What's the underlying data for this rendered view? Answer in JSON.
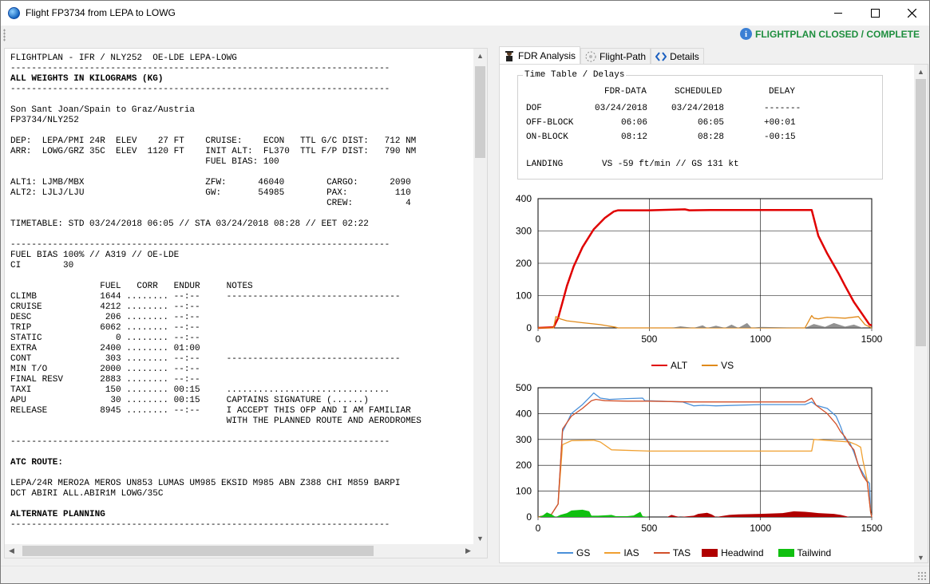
{
  "window": {
    "title": "Flight FP3734 from LEPA to LOWG",
    "status": "FLIGHTPLAN CLOSED / COMPLETE",
    "status_color": "#1e8e3e"
  },
  "ofp_lines": [
    {
      "text": "FLIGHTPLAN - IFR / NLY252  OE-LDE LEPA-LOWG",
      "bold": false
    },
    {
      "text": "------------------------------------------------------------------------",
      "bold": false
    },
    {
      "text": "ALL WEIGHTS IN KILOGRAMS (KG)",
      "bold": true
    },
    {
      "text": "------------------------------------------------------------------------",
      "bold": false
    },
    {
      "text": "",
      "bold": false
    },
    {
      "text": "Son Sant Joan/Spain to Graz/Austria",
      "bold": false
    },
    {
      "text": "FP3734/NLY252",
      "bold": false
    },
    {
      "text": "",
      "bold": false
    },
    {
      "text": "DEP:  LEPA/PMI 24R  ELEV    27 FT    CRUISE:    ECON   TTL G/C DIST:   712 NM",
      "bold": false
    },
    {
      "text": "ARR:  LOWG/GRZ 35C  ELEV  1120 FT    INIT ALT:  FL370  TTL F/P DIST:   790 NM",
      "bold": false
    },
    {
      "text": "                                     FUEL BIAS: 100",
      "bold": false
    },
    {
      "text": "",
      "bold": false
    },
    {
      "text": "ALT1: LJMB/MBX                       ZFW:      46040        CARGO:      2090",
      "bold": false
    },
    {
      "text": "ALT2: LJLJ/LJU                       GW:       54985        PAX:         110",
      "bold": false
    },
    {
      "text": "                                                            CREW:          4",
      "bold": false
    },
    {
      "text": "",
      "bold": false
    },
    {
      "text": "TIMETABLE: STD 03/24/2018 06:05 // STA 03/24/2018 08:28 // EET 02:22",
      "bold": false
    },
    {
      "text": "",
      "bold": false
    },
    {
      "text": "------------------------------------------------------------------------",
      "bold": false
    },
    {
      "text": "FUEL BIAS 100% // A319 // OE-LDE",
      "bold": false
    },
    {
      "text": "CI        30",
      "bold": false
    },
    {
      "text": "",
      "bold": false
    },
    {
      "text": "                 FUEL   CORR   ENDUR     NOTES",
      "bold": false
    },
    {
      "text": "CLIMB            1644 ........ --:--     ---------------------------------",
      "bold": false
    },
    {
      "text": "CRUISE           4212 ........ --:--",
      "bold": false
    },
    {
      "text": "DESC              206 ........ --:--",
      "bold": false
    },
    {
      "text": "TRIP             6062 ........ --:--",
      "bold": false
    },
    {
      "text": "STATIC              0 ........ --:--",
      "bold": false
    },
    {
      "text": "EXTRA            2400 ........ 01:00",
      "bold": false
    },
    {
      "text": "CONT              303 ........ --:--     ---------------------------------",
      "bold": false
    },
    {
      "text": "MIN T/O          2000 ........ --:--",
      "bold": false
    },
    {
      "text": "FINAL RESV       2883 ........ --:--",
      "bold": false
    },
    {
      "text": "TAXI              150 ........ 00:15     ...............................",
      "bold": false
    },
    {
      "text": "APU                30 ........ 00:15     CAPTAINS SIGNATURE (......)",
      "bold": false
    },
    {
      "text": "RELEASE          8945 ........ --:--     I ACCEPT THIS OFP AND I AM FAMILIAR",
      "bold": false
    },
    {
      "text": "                                         WITH THE PLANNED ROUTE AND AERODROMES",
      "bold": false
    },
    {
      "text": "",
      "bold": false
    },
    {
      "text": "------------------------------------------------------------------------",
      "bold": false
    },
    {
      "text": "",
      "bold": false
    },
    {
      "text": "ATC ROUTE:",
      "bold": true
    },
    {
      "text": "",
      "bold": false
    },
    {
      "text": "LEPA/24R MERO2A MEROS UN853 LUMAS UM985 EKSID M985 ABN Z388 CHI M859 BARPI",
      "bold": false
    },
    {
      "text": "DCT ABIRI ALL.ABIR1M LOWG/35C",
      "bold": false
    },
    {
      "text": "",
      "bold": false
    },
    {
      "text": "ALTERNATE PLANNING",
      "bold": true
    },
    {
      "text": "------------------------------------------------------------------------",
      "bold": false
    }
  ],
  "tabs": [
    {
      "label": "FDR Analysis",
      "icon": "pilot-icon",
      "active": true
    },
    {
      "label": "Flight-Path",
      "icon": "radar-icon",
      "active": false
    },
    {
      "label": "Details",
      "icon": "code-icon",
      "active": false
    }
  ],
  "timetable": {
    "title": "Time Table / Delays",
    "col_fdr": "FDR-DATA",
    "col_sched": "SCHEDULED",
    "col_delay": "DELAY",
    "rows": [
      {
        "label": "DOF",
        "fdr": "03/24/2018",
        "sched": "03/24/2018",
        "delay": "-------"
      },
      {
        "label": "OFF-BLOCK",
        "fdr": "06:06",
        "sched": "06:05",
        "delay": "+00:01"
      },
      {
        "label": "ON-BLOCK",
        "fdr": "08:12",
        "sched": "08:28",
        "delay": "-00:15"
      }
    ],
    "landing_label": "LANDING",
    "landing_value": "VS -59 ft/min // GS 131 kt"
  },
  "chart_data": [
    {
      "type": "line",
      "xlim": [
        0,
        1500
      ],
      "ylim": [
        0,
        400
      ],
      "xticks": [
        "0",
        "500",
        "1000",
        "1500"
      ],
      "yticks": [
        "0",
        "100",
        "200",
        "300",
        "400"
      ],
      "grid": true,
      "legend_position": "bottom",
      "series": [
        {
          "name": "ALT",
          "color": "#e00000",
          "x": [
            0,
            70,
            90,
            110,
            130,
            160,
            200,
            250,
            300,
            340,
            360,
            500,
            660,
            680,
            800,
            1000,
            1100,
            1230,
            1260,
            1300,
            1350,
            1380,
            1420,
            1460,
            1490,
            1500
          ],
          "y": [
            0,
            2,
            30,
            80,
            130,
            190,
            250,
            305,
            340,
            360,
            364,
            364,
            367,
            364,
            365,
            365,
            365,
            365,
            285,
            230,
            170,
            130,
            80,
            40,
            10,
            8
          ]
        },
        {
          "name": "VS",
          "color": "#e08a1a",
          "x": [
            0,
            70,
            80,
            100,
            130,
            200,
            280,
            350,
            360,
            1200,
            1230,
            1240,
            1260,
            1300,
            1380,
            1440,
            1470,
            1500
          ],
          "y": [
            0,
            0,
            35,
            28,
            22,
            16,
            10,
            2,
            0,
            0,
            38,
            30,
            28,
            33,
            30,
            35,
            10,
            0
          ]
        },
        {
          "name": "",
          "color": "#777777",
          "x": [
            600,
            640,
            700,
            740,
            760,
            800,
            840,
            870,
            900,
            940,
            960,
            1000,
            1200,
            1240,
            1290,
            1330,
            1380,
            1420,
            1460
          ],
          "y": [
            0,
            5,
            0,
            8,
            0,
            7,
            0,
            10,
            0,
            15,
            0,
            3,
            0,
            12,
            3,
            15,
            4,
            10,
            0
          ]
        }
      ]
    },
    {
      "type": "line",
      "xlim": [
        0,
        1500
      ],
      "ylim": [
        0,
        500
      ],
      "xticks": [
        "0",
        "500",
        "1000",
        "1500"
      ],
      "yticks": [
        "0",
        "100",
        "200",
        "300",
        "400",
        "500"
      ],
      "grid": true,
      "legend_position": "bottom",
      "series": [
        {
          "name": "GS",
          "color": "#4a90d9",
          "x": [
            0,
            60,
            90,
            110,
            150,
            200,
            240,
            250,
            280,
            320,
            400,
            470,
            480,
            650,
            700,
            740,
            800,
            1000,
            1200,
            1230,
            1250,
            1300,
            1340,
            1360,
            1380,
            1400,
            1420,
            1440,
            1460,
            1480,
            1490,
            1495,
            1500
          ],
          "y": [
            0,
            10,
            50,
            330,
            400,
            435,
            470,
            480,
            460,
            455,
            458,
            460,
            450,
            445,
            430,
            432,
            430,
            435,
            435,
            445,
            432,
            420,
            390,
            350,
            300,
            290,
            250,
            200,
            170,
            140,
            130,
            20,
            0
          ]
        },
        {
          "name": "IAS",
          "color": "#f0a030",
          "x": [
            0,
            60,
            90,
            110,
            150,
            250,
            280,
            330,
            500,
            1000,
            1230,
            1240,
            1400,
            1430,
            1450,
            1460,
            1480,
            1495,
            1500
          ],
          "y": [
            0,
            10,
            50,
            280,
            295,
            297,
            290,
            260,
            255,
            255,
            255,
            300,
            290,
            280,
            270,
            220,
            140,
            20,
            0
          ]
        },
        {
          "name": "TAS",
          "color": "#d2502a",
          "x": [
            0,
            60,
            90,
            110,
            150,
            200,
            240,
            260,
            300,
            400,
            500,
            700,
            1000,
            1200,
            1230,
            1250,
            1300,
            1340,
            1360,
            1380,
            1400,
            1420,
            1440,
            1460,
            1480,
            1495,
            1500
          ],
          "y": [
            0,
            10,
            50,
            340,
            390,
            420,
            450,
            455,
            450,
            448,
            448,
            445,
            445,
            445,
            460,
            432,
            400,
            360,
            330,
            310,
            280,
            260,
            200,
            160,
            135,
            20,
            0
          ]
        },
        {
          "name": "Headwind",
          "color": "#b00000",
          "fill": true,
          "x": [
            580,
            600,
            620,
            640,
            700,
            720,
            760,
            780,
            800,
            860,
            900,
            1000,
            1100,
            1150,
            1200,
            1230,
            1260,
            1330,
            1360,
            1400
          ],
          "y": [
            0,
            8,
            3,
            0,
            5,
            12,
            16,
            10,
            0,
            8,
            10,
            12,
            15,
            22,
            20,
            18,
            15,
            12,
            8,
            0
          ]
        },
        {
          "name": "Tailwind",
          "color": "#10c010",
          "fill": true,
          "x": [
            0,
            20,
            40,
            60,
            80,
            100,
            130,
            150,
            200,
            230,
            240,
            270,
            330,
            350,
            400,
            430,
            460,
            470,
            500
          ],
          "y": [
            0,
            5,
            18,
            10,
            0,
            8,
            15,
            25,
            28,
            22,
            5,
            5,
            8,
            3,
            3,
            6,
            20,
            3,
            0
          ]
        }
      ]
    }
  ]
}
